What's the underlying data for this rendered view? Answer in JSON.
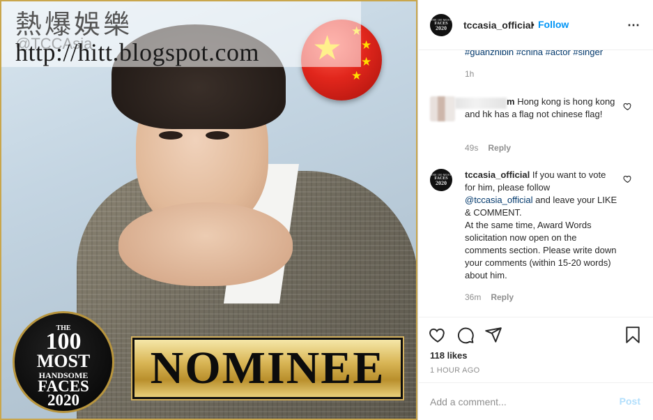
{
  "image": {
    "watermark_title": "熱爆娛樂",
    "watermark_handle": "@TCCAsia",
    "watermark_url": "http://hitt.blogspot.com",
    "badge": {
      "line1": "THE",
      "line2": "100",
      "line3": "MOST",
      "line4": "HANDSOME",
      "line5": "FACES",
      "line6": "2020"
    },
    "nominee_text": "NOMINEE",
    "colors": {
      "gold": "#c9a64c",
      "flag_red": "#e1261c",
      "flag_star": "#ffde00"
    }
  },
  "header": {
    "avatar_lines": [
      "THE 100 MOST",
      "FACES",
      "2020"
    ],
    "username": "tccasia_official",
    "separator": "•",
    "follow_label": "Follow",
    "more_icon": "⋯"
  },
  "caption": {
    "hashtags": "#guanzhibin #china #actor #singer",
    "time": "1h"
  },
  "comments": [
    {
      "user": "",
      "text": "Hong kong is hong kong and hk has a flag not chinese flag!",
      "visible_prefix": "m",
      "time": "49s",
      "reply_label": "Reply"
    },
    {
      "user": "tccasia_official",
      "text_before": "If you want to vote for him, please follow",
      "mention": "@tccasia_official",
      "text_after": "and leave your LIKE & COMMENT.",
      "text_2": "At the same time, Award Words solicitation now open on the comments section. Please write down your comments (within 15-20 words) about him.",
      "time": "36m",
      "reply_label": "Reply"
    }
  ],
  "actions": {
    "like_icon": "heart-icon",
    "comment_icon": "comment-icon",
    "share_icon": "share-icon",
    "save_icon": "bookmark-icon"
  },
  "likes": "118 likes",
  "posted_time": "1 HOUR AGO",
  "add_comment": {
    "placeholder": "Add a comment...",
    "post_label": "Post"
  },
  "colors": {
    "accent": "#0095f6",
    "link": "#00376b",
    "muted": "#8e8e8e",
    "post_disabled": "#b2dffc"
  }
}
